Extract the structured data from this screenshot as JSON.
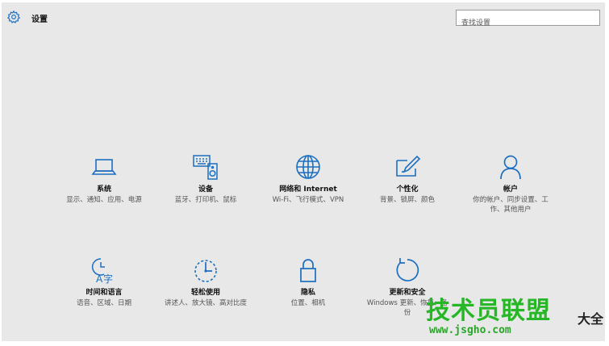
{
  "header": {
    "icon": "gear-icon",
    "title": "设置"
  },
  "search": {
    "placeholder": "查找设置"
  },
  "accent_color": "#1c6fc0",
  "categories": [
    {
      "icon": "laptop-icon",
      "name": "系统",
      "desc": "显示、通知、应用、电源"
    },
    {
      "icon": "devices-icon",
      "name": "设备",
      "desc": "蓝牙、打印机、鼠标"
    },
    {
      "icon": "globe-icon",
      "name": "网络和 Internet",
      "desc": "Wi-Fi、飞行模式、VPN"
    },
    {
      "icon": "pen-tablet-icon",
      "name": "个性化",
      "desc": "背景、锁屏、颜色"
    },
    {
      "icon": "person-icon",
      "name": "帐户",
      "desc": "你的帐户、同步设置、工作、其他用户"
    },
    {
      "icon": "time-language-icon",
      "name": "时间和语言",
      "desc": "语音、区域、日期"
    },
    {
      "icon": "ease-of-access-icon",
      "name": "轻松使用",
      "desc": "讲述人、放大镜、高对比度"
    },
    {
      "icon": "lock-icon",
      "name": "隐私",
      "desc": "位置、相机"
    },
    {
      "icon": "refresh-icon",
      "name": "更新和安全",
      "desc": "Windows 更新、恢复、备份"
    }
  ],
  "watermark": {
    "main": "技术员联盟",
    "url": "www.jsgho.com",
    "side": "大全"
  }
}
